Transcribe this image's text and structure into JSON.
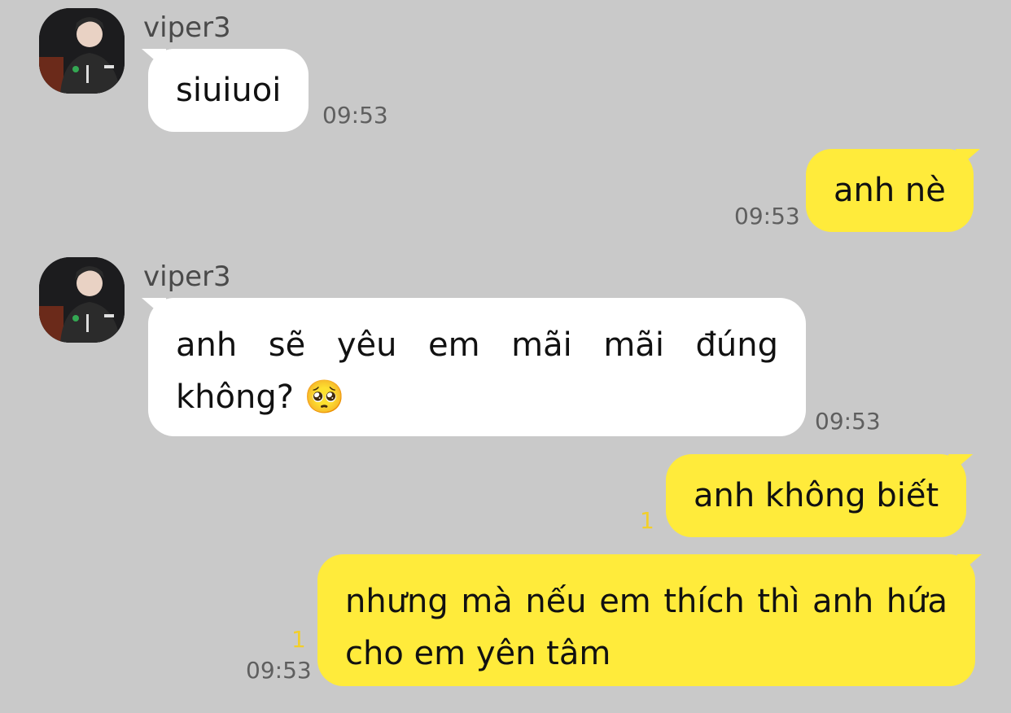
{
  "colors": {
    "background": "#c9c9c9",
    "incoming_bubble": "#ffffff",
    "outgoing_bubble": "#ffeb3b",
    "unread_count": "#f2cf2a"
  },
  "messages": [
    {
      "direction": "incoming",
      "sender": "viper3",
      "text": "siuiuoi",
      "time": "09:53"
    },
    {
      "direction": "outgoing",
      "text": "anh nè",
      "time": "09:53"
    },
    {
      "direction": "incoming",
      "sender": "viper3",
      "text": "anh sẽ yêu em mãi mãi đúng không? 🥺",
      "time": "09:53"
    },
    {
      "direction": "outgoing",
      "text": "anh không biết",
      "unread": "1"
    },
    {
      "direction": "outgoing",
      "text": "nhưng mà nếu em thích thì anh hứa cho em yên tâm",
      "unread": "1",
      "time": "09:53"
    }
  ],
  "icons": {
    "avatar": "profile-photo",
    "emoji": "pleading-face"
  }
}
